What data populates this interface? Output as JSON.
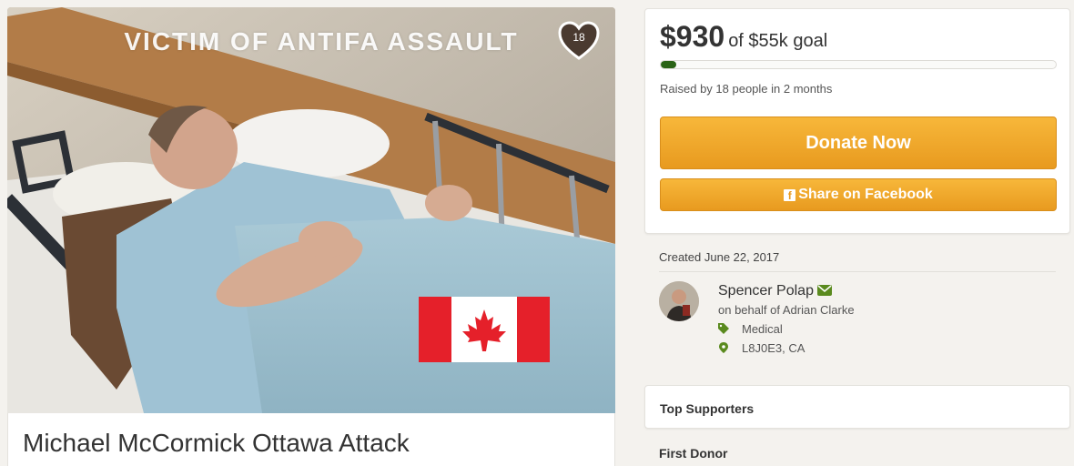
{
  "hero": {
    "caption": "VICTIM OF ANTIFA ASSAULT",
    "heart_count": "18"
  },
  "campaign": {
    "title": "Michael McCormick Ottawa Attack"
  },
  "donation": {
    "amount": "$930",
    "goal": "of $55k goal",
    "progress_fraction": 0.017,
    "raised_by": "Raised by 18 people in 2 months",
    "donate_label": "Donate Now",
    "share_label": "Share on Facebook"
  },
  "organizer": {
    "created": "Created June 22, 2017",
    "name": "Spencer Polap",
    "on_behalf": "on behalf of Adrian Clarke",
    "category": "Medical",
    "location": "L8J0E3, CA"
  },
  "sections": {
    "top_supporters": "Top Supporters",
    "first_donor": "First Donor"
  },
  "colors": {
    "accent_orange": "#f2a62c",
    "progress_green": "#2a6315",
    "icon_green": "#5a8a1e"
  },
  "icons": {
    "heart": "heart-icon",
    "facebook": "facebook-icon",
    "mail": "mail-icon",
    "tag": "tag-icon",
    "location": "location-pin-icon"
  }
}
